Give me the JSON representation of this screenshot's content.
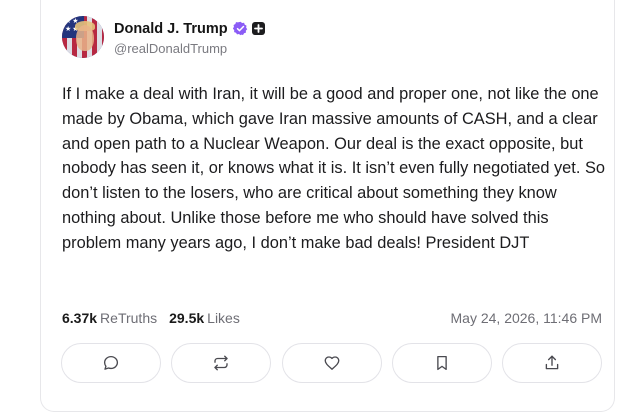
{
  "post": {
    "author": {
      "display_name": "Donald J. Trump",
      "handle": "@realDonaldTrump",
      "verified_color": "#8b5cf6"
    },
    "text": "If I make a deal with Iran, it will be a good and proper one, not like the one made by Obama, which gave Iran massive amounts of CASH, and a clear and open path to a Nuclear Weapon. Our deal is the exact opposite, but nobody has seen it, or knows what it is. It isn’t even fully negotiated yet. So don’t listen to the losers, who are critical about something they know nothing about. Unlike those before me who should have solved this problem many years ago, I don’t make bad deals! President DJT",
    "stats": {
      "retruths_count": "6.37k",
      "retruths_label": "ReTruths",
      "likes_count": "29.5k",
      "likes_label": "Likes"
    },
    "timestamp": "May 24, 2026, 11:46 PM"
  },
  "actions": [
    {
      "icon": "comment-icon"
    },
    {
      "icon": "retruth-icon"
    },
    {
      "icon": "heart-icon"
    },
    {
      "icon": "bookmark-icon"
    },
    {
      "icon": "share-icon"
    }
  ]
}
